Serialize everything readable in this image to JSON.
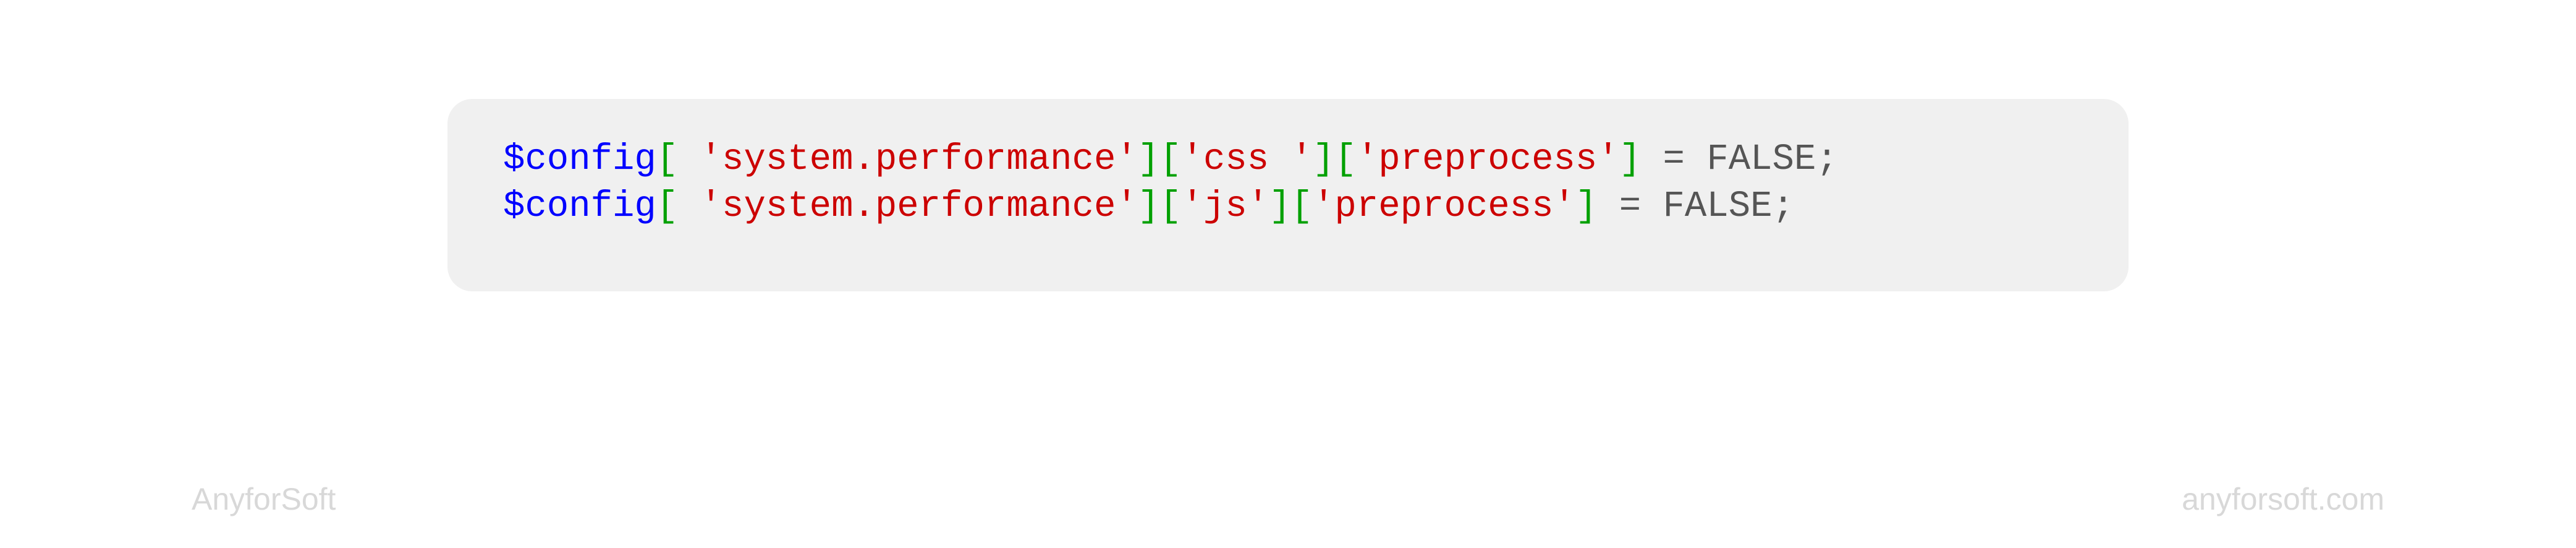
{
  "code": {
    "line1": {
      "variable": "$config",
      "bracket1_open": "[ ",
      "string1": "'system.performance'",
      "bracket1_close": "]",
      "bracket2_open": "[",
      "string2": "'css '",
      "bracket2_close": "]",
      "bracket3_open": "[",
      "string3": "'preprocess'",
      "bracket3_close": "]",
      "assignment": " = FALSE;"
    },
    "line2": {
      "variable": "$config",
      "bracket1_open": "[ ",
      "string1": "'system.performance'",
      "bracket1_close": "]",
      "bracket2_open": "[",
      "string2": "'js'",
      "bracket2_close": "]",
      "bracket3_open": "[",
      "string3": "'preprocess'",
      "bracket3_close": "]",
      "assignment": " = FALSE;"
    }
  },
  "footer": {
    "brand": "AnyforSoft",
    "url": "anyforsoft.com"
  }
}
